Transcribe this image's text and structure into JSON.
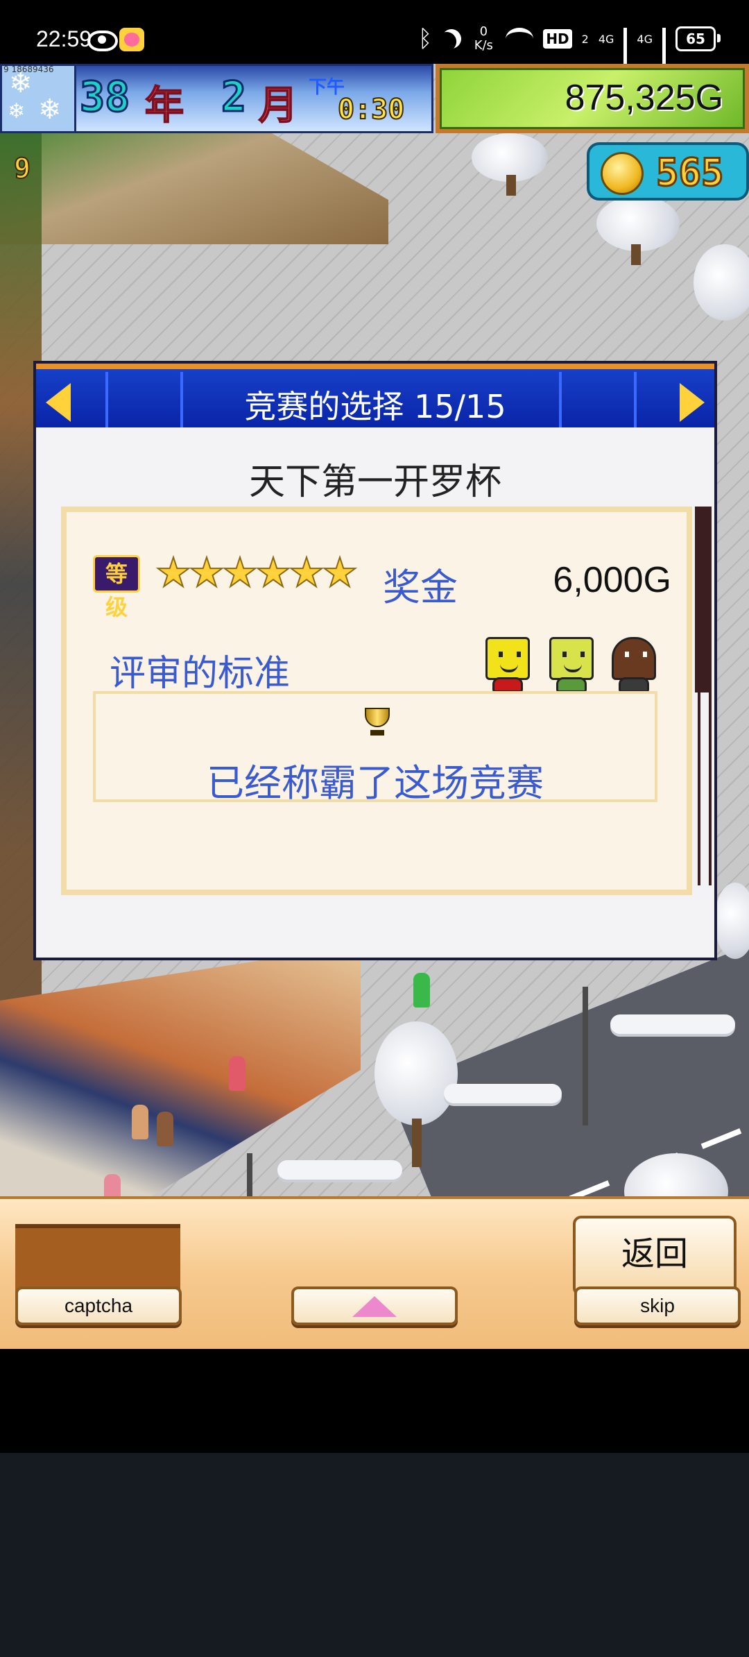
{
  "status_bar": {
    "time": "22:59",
    "speed_value": "0",
    "speed_unit": "K/s",
    "hd_label": "HD",
    "hd_sub": "2",
    "sim1_label": "4G",
    "sim2_label": "4G",
    "battery": "65"
  },
  "hud": {
    "year_number": "38",
    "year_unit": "年",
    "month_number": "2",
    "month_unit": "月",
    "ampm": "下午",
    "clock": "0:30",
    "money": "875,325G",
    "coins": "565",
    "store_level": "9",
    "debug_id": "9 18689436"
  },
  "dialog": {
    "title": "竞赛的选择 15/15",
    "contest_name": "天下第一开罗杯",
    "rank_label": "等级",
    "stars": 6,
    "prize_label": "奖金",
    "prize_value": "6,000G",
    "criteria_label": "评审的标准",
    "result_text": "已经称霸了这场竞赛"
  },
  "bottom_bar": {
    "captcha_label": "captcha",
    "back_label": "返回",
    "skip_label": "skip"
  },
  "colors": {
    "dialog_title_bg": "#1640c8",
    "accent_blue_text": "#3a5ad0",
    "money_bg": "#a9e05a",
    "coin_bg": "#2ab8d8"
  }
}
